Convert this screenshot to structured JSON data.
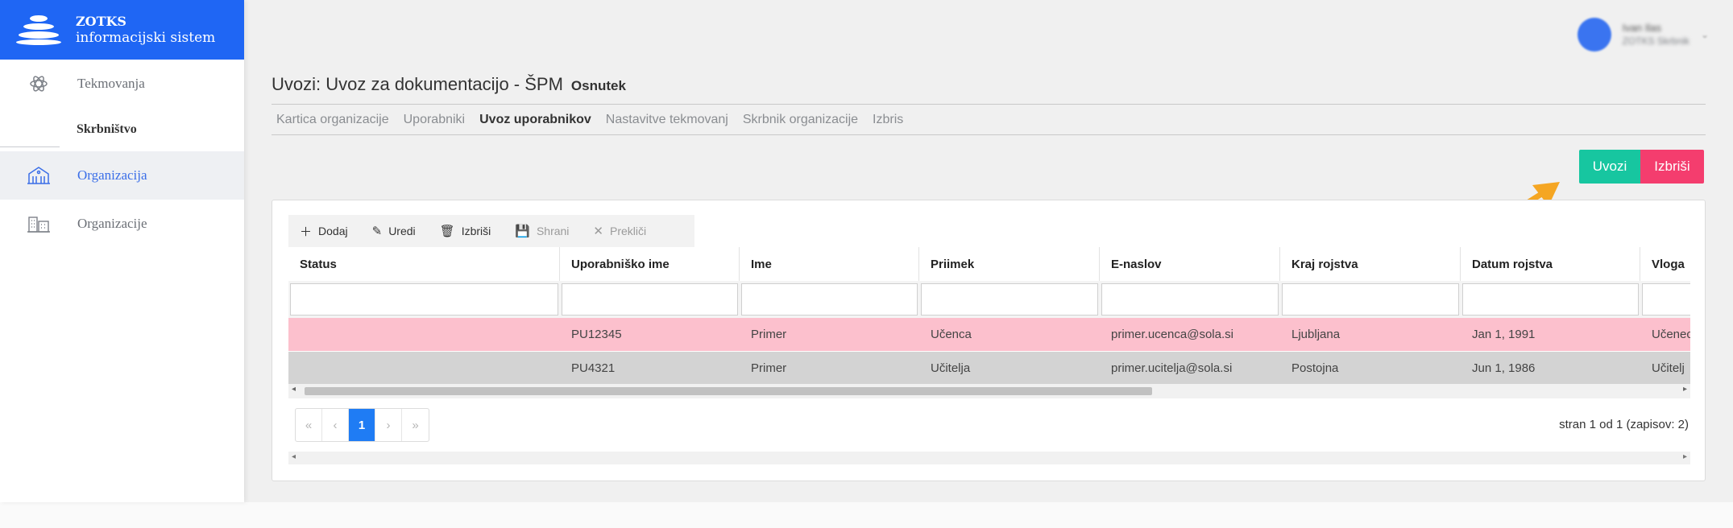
{
  "brand": {
    "title": "ZOTKS",
    "subtitle": "informacijski sistem",
    "color": "#1f66f4"
  },
  "sidebar": {
    "items": [
      {
        "label": "Tekmovanja",
        "icon": "atom-icon"
      },
      {
        "section": "Skrbništvo"
      },
      {
        "label": "Organizacija",
        "icon": "institution-icon",
        "active": true
      },
      {
        "label": "Organizacije",
        "icon": "buildings-icon"
      }
    ]
  },
  "user": {
    "name": "Ivan Ilas",
    "role": "ZOTKS Skrbnik"
  },
  "page": {
    "title": "Uvozi: Uvoz za dokumentacijo - ŠPM",
    "badge": "Osnutek"
  },
  "tabs": [
    {
      "label": "Kartica organizacije"
    },
    {
      "label": "Uporabniki"
    },
    {
      "label": "Uvoz uporabnikov",
      "active": true
    },
    {
      "label": "Nastavitve tekmovanj"
    },
    {
      "label": "Skrbnik organizacije"
    },
    {
      "label": "Izbris"
    }
  ],
  "actions": {
    "import_label": "Uvozi",
    "delete_label": "Izbriši",
    "import_color": "#17c6a0",
    "delete_color": "#f43d6e"
  },
  "toolbar": {
    "add": "Dodaj",
    "edit": "Uredi",
    "delete": "Izbriši",
    "save": "Shrani",
    "cancel": "Prekliči"
  },
  "grid": {
    "columns": [
      "Status",
      "Uporabniško ime",
      "Ime",
      "Priimek",
      "E-naslov",
      "Kraj rojstva",
      "Datum rojstva",
      "Vloga"
    ],
    "rows": [
      [
        "",
        "PU12345",
        "Primer",
        "Učenca",
        "primer.ucenca@sola.si",
        "Ljubljana",
        "Jan 1, 1991",
        "Učenec"
      ],
      [
        "",
        "PU4321",
        "Primer",
        "Učitelja",
        "primer.ucitelja@sola.si",
        "Postojna",
        "Jun 1, 1986",
        "Učitelj"
      ]
    ],
    "row_colors": [
      "#fcc0cd",
      "#d3d3d3"
    ]
  },
  "pager": {
    "first": "«",
    "prev": "‹",
    "current": "1",
    "next": "›",
    "last": "»",
    "info": "stran 1 od 1 (zapisov: 2)"
  }
}
